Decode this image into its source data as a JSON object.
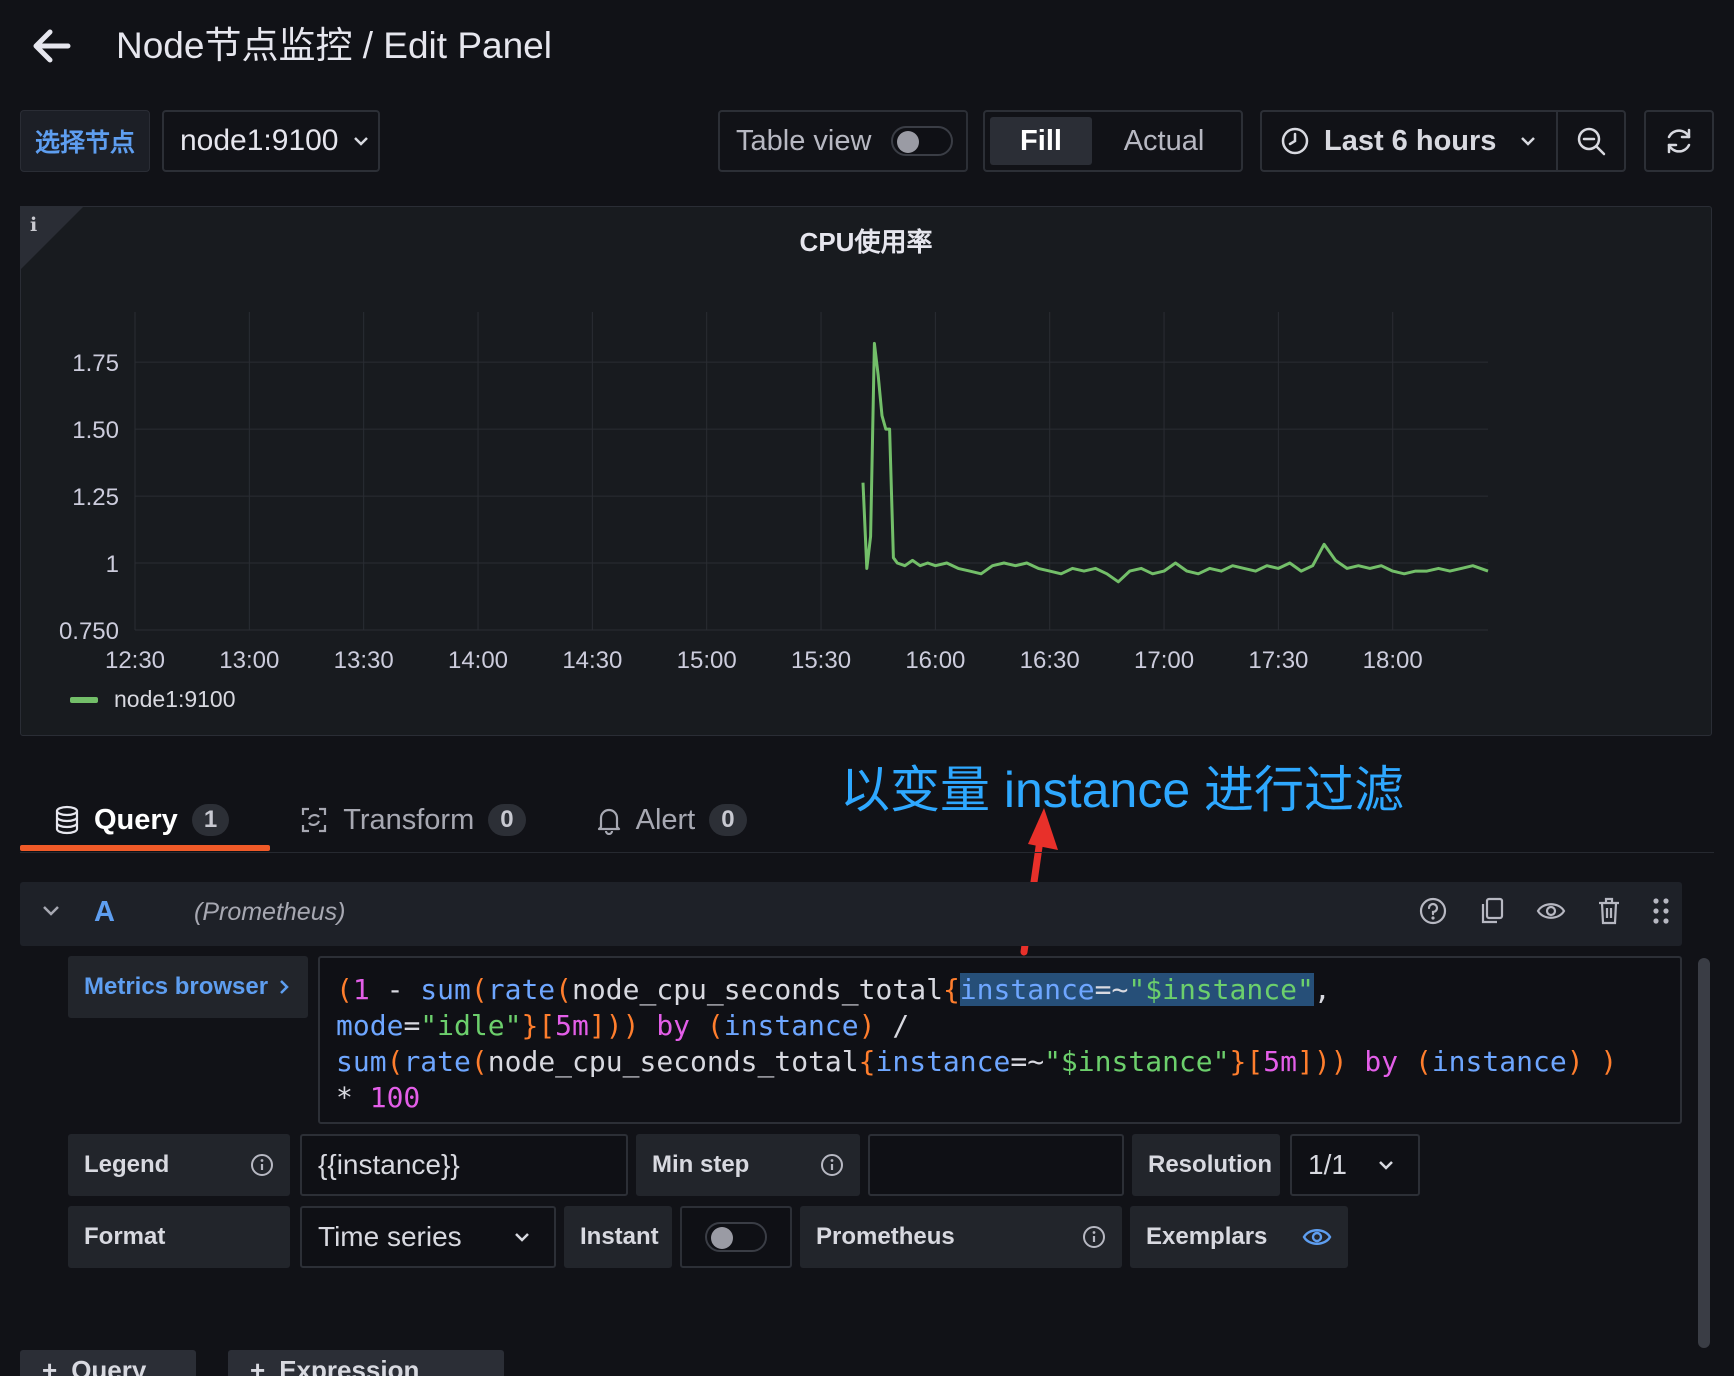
{
  "header": {
    "title": "Node节点监控 / Edit Panel"
  },
  "toolbar": {
    "variable_label": "选择节点",
    "variable_value": "node1:9100",
    "table_view_label": "Table view",
    "fill_label": "Fill",
    "actual_label": "Actual",
    "time_range": "Last 6 hours"
  },
  "panel": {
    "title": "CPU使用率",
    "info_glyph": "i"
  },
  "chart_data": {
    "type": "line",
    "title": "CPU使用率",
    "xlabel": "",
    "ylabel": "",
    "x_ticks": [
      "12:30",
      "13:00",
      "13:30",
      "14:00",
      "14:30",
      "15:00",
      "15:30",
      "16:00",
      "16:30",
      "17:00",
      "17:30",
      "18:00"
    ],
    "y_ticks": [
      "0.750",
      "1",
      "1.25",
      "1.50",
      "1.75"
    ],
    "ylim": [
      0.75,
      1.75
    ],
    "grid": true,
    "legend_position": "bottom-left",
    "series": [
      {
        "name": "node1:9100",
        "color": "#73bf69",
        "points": [
          [
            "15:41",
            1.3
          ],
          [
            "15:42",
            0.98
          ],
          [
            "15:43",
            1.1
          ],
          [
            "15:44",
            1.82
          ],
          [
            "15:45",
            1.7
          ],
          [
            "15:46",
            1.55
          ],
          [
            "15:47",
            1.5
          ],
          [
            "15:48",
            1.5
          ],
          [
            "15:49",
            1.02
          ],
          [
            "15:50",
            1.0
          ],
          [
            "15:52",
            0.99
          ],
          [
            "15:54",
            1.01
          ],
          [
            "15:56",
            0.99
          ],
          [
            "15:58",
            1.0
          ],
          [
            "16:00",
            0.99
          ],
          [
            "16:03",
            1.0
          ],
          [
            "16:06",
            0.98
          ],
          [
            "16:09",
            0.97
          ],
          [
            "16:12",
            0.96
          ],
          [
            "16:15",
            0.99
          ],
          [
            "16:18",
            1.0
          ],
          [
            "16:21",
            0.99
          ],
          [
            "16:24",
            1.0
          ],
          [
            "16:27",
            0.98
          ],
          [
            "16:30",
            0.97
          ],
          [
            "16:33",
            0.96
          ],
          [
            "16:36",
            0.98
          ],
          [
            "16:39",
            0.97
          ],
          [
            "16:42",
            0.98
          ],
          [
            "16:45",
            0.96
          ],
          [
            "16:48",
            0.93
          ],
          [
            "16:51",
            0.97
          ],
          [
            "16:54",
            0.98
          ],
          [
            "16:57",
            0.96
          ],
          [
            "17:00",
            0.97
          ],
          [
            "17:03",
            1.0
          ],
          [
            "17:06",
            0.97
          ],
          [
            "17:09",
            0.96
          ],
          [
            "17:12",
            0.98
          ],
          [
            "17:15",
            0.97
          ],
          [
            "17:18",
            0.99
          ],
          [
            "17:21",
            0.98
          ],
          [
            "17:24",
            0.97
          ],
          [
            "17:27",
            0.99
          ],
          [
            "17:30",
            0.98
          ],
          [
            "17:33",
            1.0
          ],
          [
            "17:36",
            0.97
          ],
          [
            "17:39",
            0.99
          ],
          [
            "17:42",
            1.07
          ],
          [
            "17:45",
            1.01
          ],
          [
            "17:48",
            0.98
          ],
          [
            "17:51",
            0.99
          ],
          [
            "17:54",
            0.98
          ],
          [
            "17:57",
            0.99
          ],
          [
            "18:00",
            0.97
          ],
          [
            "18:03",
            0.96
          ],
          [
            "18:06",
            0.97
          ],
          [
            "18:09",
            0.97
          ],
          [
            "18:12",
            0.98
          ],
          [
            "18:15",
            0.97
          ],
          [
            "18:18",
            0.98
          ],
          [
            "18:21",
            0.99
          ],
          [
            "18:25",
            0.97
          ]
        ]
      }
    ]
  },
  "annotation": {
    "text": "以变量 instance 进行过滤",
    "color": "#2ea8ff"
  },
  "tabs": [
    {
      "label": "Query",
      "count": "1",
      "icon": "database-icon",
      "active": true
    },
    {
      "label": "Transform",
      "count": "0",
      "icon": "transform-icon",
      "active": false
    },
    {
      "label": "Alert",
      "count": "0",
      "icon": "bell-icon",
      "active": false
    }
  ],
  "query": {
    "ref_id": "A",
    "datasource": "(Prometheus)",
    "metrics_browser_label": "Metrics browser",
    "expr_line1": "(1 - sum(rate(node_cpu_seconds_total{instance=~\"$instance\",",
    "expr_line2": "mode=\"idle\"}[5m])) by (instance) /",
    "expr_line3": "sum(rate(node_cpu_seconds_total{instance=~\"$instance\"}[5m])) by (instance) )",
    "expr_line4": "* 100"
  },
  "options": {
    "legend_label": "Legend",
    "legend_value": "{{instance}}",
    "min_step_label": "Min step",
    "min_step_value": "",
    "resolution_label": "Resolution",
    "resolution_value": "1/1",
    "format_label": "Format",
    "format_value": "Time series",
    "instant_label": "Instant",
    "prometheus_label": "Prometheus",
    "exemplars_label": "Exemplars"
  },
  "bottom_buttons": {
    "query_label": "Query",
    "expression_label": "Expression"
  },
  "colors": {
    "accent_blue": "#5e9ef0",
    "active_tab_underline": "#f05a28",
    "series_green": "#73bf69"
  }
}
